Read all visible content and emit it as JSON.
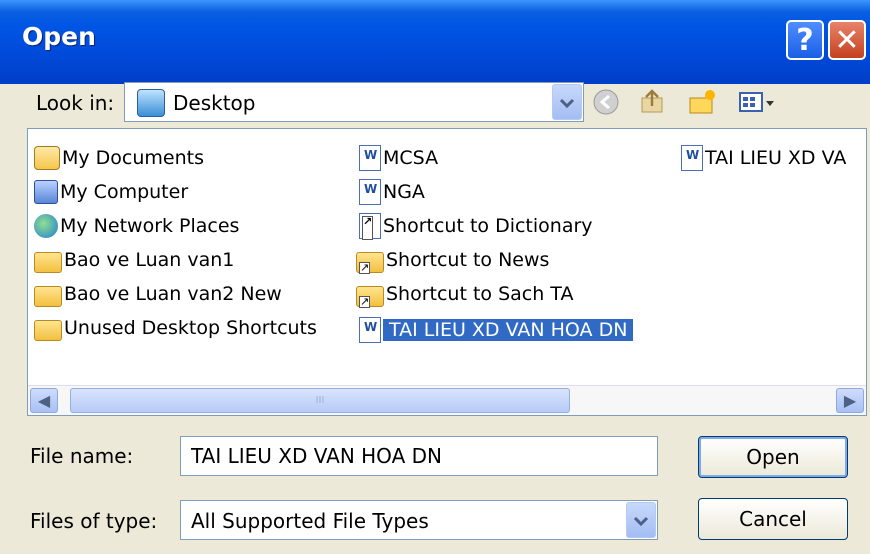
{
  "window": {
    "title": "Open",
    "help_glyph": "?",
    "close_glyph": "✕"
  },
  "toolbar": {
    "look_in_label": "Look in:",
    "look_in_value": "Desktop",
    "icons": [
      "back-icon",
      "up-folder-icon",
      "new-folder-icon",
      "view-menu-icon"
    ]
  },
  "list": {
    "items": [
      {
        "label": "My Documents",
        "icon": "documents-folder-icon"
      },
      {
        "label": "My Computer",
        "icon": "computer-icon"
      },
      {
        "label": "My Network Places",
        "icon": "network-icon"
      },
      {
        "label": "Bao ve Luan van1",
        "icon": "folder-icon"
      },
      {
        "label": "Bao ve Luan van2 New",
        "icon": "folder-icon"
      },
      {
        "label": "Unused Desktop Shortcuts",
        "icon": "folder-icon"
      },
      {
        "label": "MCSA",
        "icon": "word-document-icon"
      },
      {
        "label": "NGA",
        "icon": "word-document-icon"
      },
      {
        "label": "Shortcut to Dictionary",
        "icon": "document-shortcut-icon"
      },
      {
        "label": "Shortcut to News",
        "icon": "folder-shortcut-icon"
      },
      {
        "label": "Shortcut to Sach TA",
        "icon": "folder-shortcut-icon"
      },
      {
        "label": "TAI LIEU XD VAN HOA DN",
        "icon": "word-document-icon",
        "selected": true
      },
      {
        "label": "TAI LIEU XD VA",
        "icon": "word-document-icon"
      }
    ],
    "scroll_grip": "III"
  },
  "footer": {
    "file_name_label": "File name:",
    "file_name_value": "TAI LIEU XD VAN HOA DN",
    "file_type_label": "Files of type:",
    "file_type_value": "All Supported File Types",
    "open_button": "Open",
    "cancel_button": "Cancel"
  },
  "colors": {
    "titlebar": "#0055e5",
    "selection": "#316ac5",
    "dialog_bg": "#ece9d8"
  }
}
